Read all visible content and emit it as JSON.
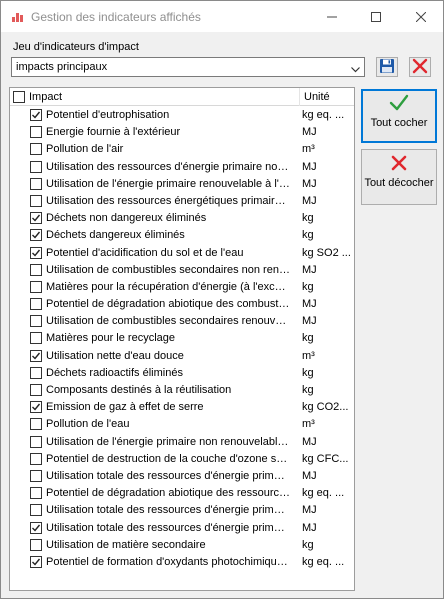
{
  "window": {
    "title": "Gestion des indicateurs affichés"
  },
  "indicator_set": {
    "label": "Jeu d'indicateurs d'impact",
    "selected": "impacts principaux"
  },
  "grid": {
    "columns": {
      "impact": "Impact",
      "unit": "Unité"
    },
    "rows": [
      {
        "impact": "Potentiel d'eutrophisation",
        "unit": "kg eq. ...",
        "checked": true
      },
      {
        "impact": "Energie fournie à l'extérieur",
        "unit": "MJ",
        "checked": false
      },
      {
        "impact": "Pollution de l'air",
        "unit": "m³",
        "checked": false
      },
      {
        "impact": "Utilisation des ressources d'énergie primaire non r...",
        "unit": "MJ",
        "checked": false
      },
      {
        "impact": "Utilisation de l'énergie primaire renouvelable à l'ex...",
        "unit": "MJ",
        "checked": false
      },
      {
        "impact": "Utilisation des ressources énergétiques primaires r...",
        "unit": "MJ",
        "checked": false
      },
      {
        "impact": "Déchets non dangereux éliminés",
        "unit": "kg",
        "checked": true
      },
      {
        "impact": "Déchets dangereux éliminés",
        "unit": "kg",
        "checked": true
      },
      {
        "impact": "Potentiel d'acidification du sol et de l'eau",
        "unit": "kg SO2 ...",
        "checked": true
      },
      {
        "impact": "Utilisation de combustibles secondaires non renou...",
        "unit": "MJ",
        "checked": false
      },
      {
        "impact": "Matières pour la récupération d'énergie (à l'excep...",
        "unit": "kg",
        "checked": false
      },
      {
        "impact": "Potentiel de dégradation abiotique des combustibl...",
        "unit": "MJ",
        "checked": false
      },
      {
        "impact": "Utilisation de combustibles secondaires renouvela...",
        "unit": "MJ",
        "checked": false
      },
      {
        "impact": "Matières pour le recyclage",
        "unit": "kg",
        "checked": false
      },
      {
        "impact": "Utilisation nette d'eau douce",
        "unit": "m³",
        "checked": true
      },
      {
        "impact": "Déchets radioactifs éliminés",
        "unit": "kg",
        "checked": false
      },
      {
        "impact": "Composants destinés à la réutilisation",
        "unit": "kg",
        "checked": false
      },
      {
        "impact": "Emission de gaz à effet de serre",
        "unit": "kg CO2...",
        "checked": true
      },
      {
        "impact": "Pollution de l'eau",
        "unit": "m³",
        "checked": false
      },
      {
        "impact": "Utilisation de l'énergie primaire non renouvelable à...",
        "unit": "MJ",
        "checked": false
      },
      {
        "impact": "Potentiel de destruction de la couche d'ozone stra...",
        "unit": "kg CFC...",
        "checked": false
      },
      {
        "impact": "Utilisation totale des ressources d'énergie primaire...",
        "unit": "MJ",
        "checked": false
      },
      {
        "impact": "Potentiel de dégradation abiotique des ressource...",
        "unit": "kg eq. ...",
        "checked": false
      },
      {
        "impact": "Utilisation totale des ressources d'énergie primaire...",
        "unit": "MJ",
        "checked": false
      },
      {
        "impact": "Utilisation totale des ressources d'énergie primaire...",
        "unit": "MJ",
        "checked": true
      },
      {
        "impact": "Utilisation de matière secondaire",
        "unit": "kg",
        "checked": false
      },
      {
        "impact": "Potentiel de formation d'oxydants photochimiques...",
        "unit": "kg eq. ...",
        "checked": true
      }
    ]
  },
  "buttons": {
    "check_all": "Tout cocher",
    "uncheck_all": "Tout décocher"
  },
  "icons": {
    "app": "bar-chart-icon",
    "save": "floppy-disk-icon",
    "delete": "red-x-icon",
    "check_all": "green-check-icon",
    "uncheck_all": "red-x-icon"
  },
  "colors": {
    "accent": "#0078d7",
    "check": "#2e9e3f",
    "cross": "#e0272e",
    "save": "#1f5aa8"
  }
}
